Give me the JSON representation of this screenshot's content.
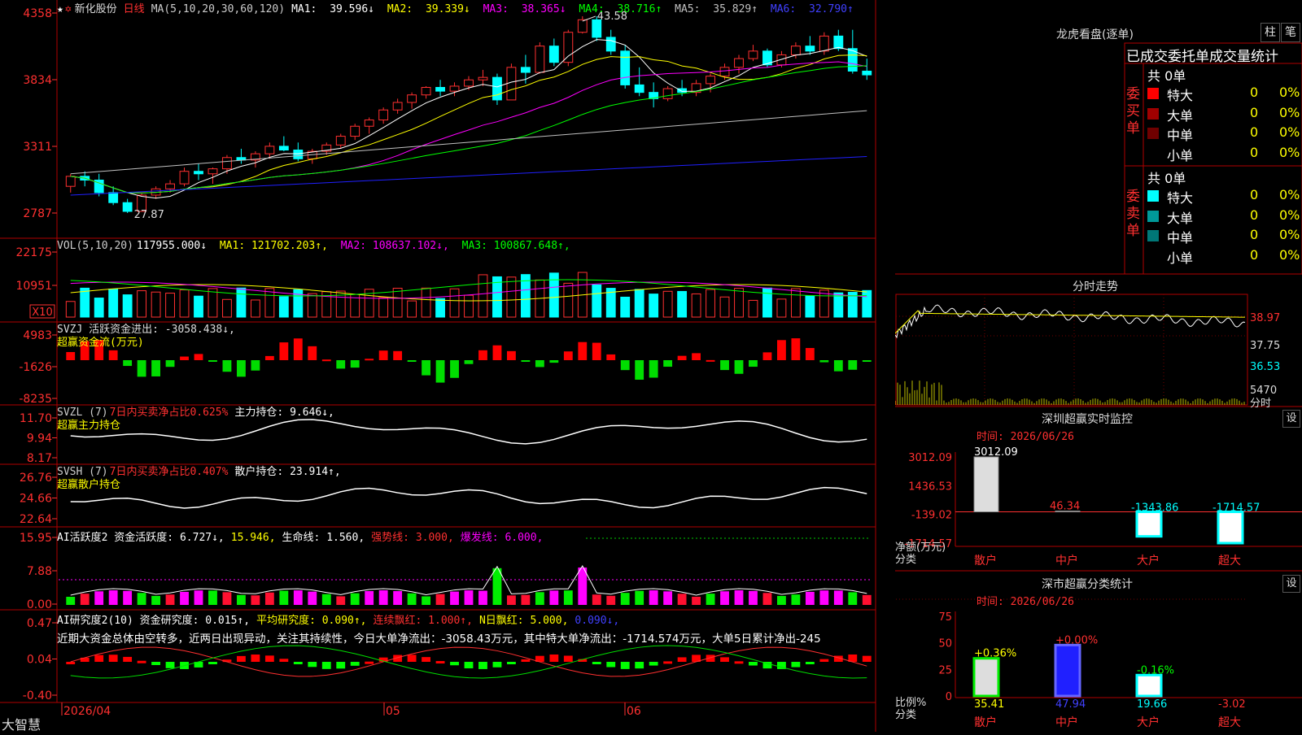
{
  "app": {
    "name": "大智慧",
    "stock": "新化股份",
    "period": "日线"
  },
  "main": {
    "header_star": "★",
    "ma_title": "MA(5,10,20,30,60,120)",
    "ma": [
      {
        "label": "MA1:",
        "value": "39.596↓",
        "color": "#ffffff"
      },
      {
        "label": "MA2:",
        "value": "39.339↓",
        "color": "#ffff00"
      },
      {
        "label": "MA3:",
        "value": "38.365↓",
        "color": "#ff00ff"
      },
      {
        "label": "MA4:",
        "value": "38.716↑",
        "color": "#00ff00"
      },
      {
        "label": "MA5:",
        "value": "35.829↑",
        "color": "#c0c0c0"
      },
      {
        "label": "MA6:",
        "value": "32.790↑",
        "color": "#4040ff"
      }
    ],
    "y_ticks": [
      "4358",
      "3834",
      "3311",
      "2787"
    ],
    "high_label": "43.58",
    "low_label": "27.87"
  },
  "vol": {
    "title": "VOL(5,10,20)",
    "value": "117955.000↓",
    "ma": [
      {
        "t": "MA1: 121702.203↑",
        "c": "#ffff00"
      },
      {
        "t": "MA2: 108637.102↓",
        "c": "#ff00ff"
      },
      {
        "t": "MA3: 100867.648↑",
        "c": "#00ff00"
      }
    ],
    "y_ticks": [
      "22175",
      "10951"
    ],
    "unit": "X10"
  },
  "svzj": {
    "title": "SVZJ  活跃资金进出: -3058.438↓,",
    "subtitle": "超赢资金流(万元)",
    "y_ticks": [
      "4983",
      "-1626",
      "-8235"
    ]
  },
  "svzl": {
    "title": "SVZL (7)",
    "ratio": "7日内买卖净占比0.625%",
    "hold": "主力持仓: 9.646↓,",
    "subtitle": "超赢主力持仓",
    "y_ticks": [
      "11.70",
      "9.94",
      "8.17"
    ]
  },
  "svsh": {
    "title": "SVSH (7)",
    "ratio": "7日内买卖净占比0.407%",
    "hold": "散户持仓: 23.914↑,",
    "subtitle": "超赢散户持仓",
    "y_ticks": [
      "26.76",
      "24.66",
      "22.64"
    ]
  },
  "ai_active": {
    "t1": "AI活跃度2 资金活跃度: 6.727↓,",
    "t2": "15.946,",
    "t3": "生命线: 1.560,",
    "t4": "强势线: 3.000,",
    "t5": "爆发线: 6.000,",
    "y_ticks": [
      "15.95",
      "7.88",
      "0.00"
    ]
  },
  "ai_research": {
    "t1": "AI研究度2(10) 资金研究度: 0.015↑,",
    "t2": "平均研究度: 0.090↑,",
    "t3": "连续飘红: 1.000↑,",
    "t4": "N日飘红: 5.000,",
    "t5": "0.090↓,",
    "comment": "近期大资金总体由空转多，近两日出现异动，关注其持续性，今日大单净流出：-3058.43万元，其中特大单净流出：-1714.574万元，大单5日累计净出-245",
    "y_ticks": [
      "0.47",
      "0.04",
      "-0.40"
    ]
  },
  "x_axis": {
    "labels": [
      "2026/04",
      "05",
      "06"
    ]
  },
  "longhu": {
    "title": "龙虎看盘(逐单)",
    "btn1": "柱",
    "btn2": "笔",
    "header": "已成交委托单成交量统计",
    "buy": {
      "side": "委买单",
      "total": "共 0单",
      "rows": [
        {
          "name": "特大",
          "v": "0",
          "p": "0%",
          "c": "#ff0000"
        },
        {
          "name": "大单",
          "v": "0",
          "p": "0%",
          "c": "#a00000"
        },
        {
          "name": "中单",
          "v": "0",
          "p": "0%",
          "c": "#700000"
        },
        {
          "name": "小单",
          "v": "0",
          "p": "0%",
          "c": "#000000"
        }
      ]
    },
    "sell": {
      "side": "委卖单",
      "total": "共 0单",
      "rows": [
        {
          "name": "特大",
          "v": "0",
          "p": "0%",
          "c": "#00ffff"
        },
        {
          "name": "大单",
          "v": "0",
          "p": "0%",
          "c": "#009999"
        },
        {
          "name": "中单",
          "v": "0",
          "p": "0%",
          "c": "#007777"
        },
        {
          "name": "小单",
          "v": "0",
          "p": "0%",
          "c": "#000000"
        }
      ]
    }
  },
  "minute": {
    "title": "分时走势",
    "y_ticks": [
      "38.97",
      "37.75",
      "36.53"
    ],
    "vol_tick": "5470",
    "vol_label": "分时"
  },
  "monitor": {
    "title": "深圳超赢实时监控",
    "set": "设",
    "date": "时间: 2026/06/26",
    "y_ticks": [
      "3012.09",
      "1436.53",
      "-139.02",
      "-1714.57"
    ],
    "unit": "净额(万元)",
    "cat_label": "分类",
    "bars": [
      {
        "cat": "散户",
        "v": 3012.09,
        "label": "3012.09"
      },
      {
        "cat": "中户",
        "v": 46.34,
        "label": "46.34"
      },
      {
        "cat": "大户",
        "v": -1343.86,
        "label": "-1343.86"
      },
      {
        "cat": "超大",
        "v": -1714.57,
        "label": "-1714.57"
      }
    ]
  },
  "classify": {
    "title": "深市超赢分类统计",
    "set": "设",
    "date": "时间: 2026/06/26",
    "y_ticks": [
      "75",
      "50",
      "25",
      "0"
    ],
    "unit": "比例%",
    "cat_label": "分类",
    "bars": [
      {
        "cat": "散户",
        "v": 35.41,
        "chg": "+0.36%",
        "label": "35.41"
      },
      {
        "cat": "中户",
        "v": 47.94,
        "chg": "+0.00%",
        "label": "47.94"
      },
      {
        "cat": "大户",
        "v": 19.66,
        "chg": "-0.16%",
        "label": "19.66"
      },
      {
        "cat": "超大",
        "v": -3.02,
        "chg": "",
        "label": "-3.02"
      }
    ]
  },
  "chart_data": [
    {
      "type": "candlestick",
      "title": "新化股份 日线",
      "ylim": [
        27.87,
        43.58
      ],
      "ohlc": [
        [
          30,
          31,
          29.5,
          30.8
        ],
        [
          30.8,
          31.2,
          30,
          30.5
        ],
        [
          30.5,
          31,
          29.2,
          29.5
        ],
        [
          29.5,
          30,
          28.5,
          28.7
        ],
        [
          28.7,
          29,
          27.87,
          28
        ],
        [
          28,
          29.5,
          28,
          29.3
        ],
        [
          29.3,
          30,
          29,
          29.8
        ],
        [
          29.8,
          30.5,
          29.5,
          30.2
        ],
        [
          30.2,
          31.5,
          30,
          31.2
        ],
        [
          31.2,
          31.8,
          30.5,
          31
        ],
        [
          31,
          31.5,
          30.2,
          31.4
        ],
        [
          31.4,
          32.5,
          31,
          32.3
        ],
        [
          32.3,
          33,
          31.8,
          32.1
        ],
        [
          32.1,
          32.8,
          31.5,
          32.6
        ],
        [
          32.6,
          33.5,
          32.2,
          33.2
        ],
        [
          33.2,
          34,
          32.8,
          32.9
        ],
        [
          32.9,
          33.5,
          32,
          32.2
        ],
        [
          32.2,
          33,
          31.8,
          32.8
        ],
        [
          32.8,
          33.5,
          32.5,
          33.3
        ],
        [
          33.3,
          34.2,
          33,
          34
        ],
        [
          34,
          35,
          33.7,
          34.8
        ],
        [
          34.8,
          35.5,
          34.2,
          35.3
        ],
        [
          35.3,
          36.3,
          35,
          36.1
        ],
        [
          36.1,
          37,
          35.8,
          36.7
        ],
        [
          36.7,
          37.5,
          36.2,
          37.3
        ],
        [
          37.3,
          38,
          37,
          37.9
        ],
        [
          37.9,
          38.5,
          37.2,
          37.6
        ],
        [
          37.6,
          38.3,
          37.2,
          38
        ],
        [
          38,
          38.8,
          37.7,
          38.5
        ],
        [
          38.5,
          39.3,
          38,
          38.7
        ],
        [
          38.7,
          39,
          36.5,
          36.9
        ],
        [
          36.9,
          39.8,
          36.9,
          39.5
        ],
        [
          39.5,
          40.5,
          38.2,
          39.1
        ],
        [
          39.1,
          41.5,
          39,
          41.2
        ],
        [
          41.2,
          41.8,
          39.6,
          39.9
        ],
        [
          39.9,
          42.5,
          39.6,
          42.3
        ],
        [
          42.3,
          43.58,
          42.2,
          43.3
        ],
        [
          43.3,
          43.58,
          41.6,
          41.9
        ],
        [
          41.9,
          42.5,
          40.5,
          40.8
        ],
        [
          40.8,
          41.3,
          37.8,
          38.1
        ],
        [
          38.1,
          39.5,
          37.2,
          37.5
        ],
        [
          37.5,
          38.3,
          36.3,
          37
        ],
        [
          37,
          38,
          36.8,
          37.8
        ],
        [
          37.8,
          38.5,
          37.2,
          37.5
        ],
        [
          37.5,
          38.5,
          37.2,
          38.2
        ],
        [
          38.2,
          39,
          37.5,
          38.8
        ],
        [
          38.8,
          39.8,
          38.5,
          39.5
        ],
        [
          39.5,
          40.5,
          39,
          40.2
        ],
        [
          40.2,
          41.3,
          40,
          40.8
        ],
        [
          40.8,
          41,
          39.5,
          39.7
        ],
        [
          39.7,
          40.8,
          39.5,
          40.5
        ],
        [
          40.5,
          41.5,
          40.2,
          41.2
        ],
        [
          41.2,
          42,
          40.5,
          40.8
        ],
        [
          40.8,
          42.3,
          40.5,
          42
        ],
        [
          42,
          42.5,
          40.8,
          41
        ],
        [
          41,
          42.5,
          39,
          39.2
        ],
        [
          39.2,
          40.2,
          38.5,
          38.9
        ]
      ]
    }
  ]
}
